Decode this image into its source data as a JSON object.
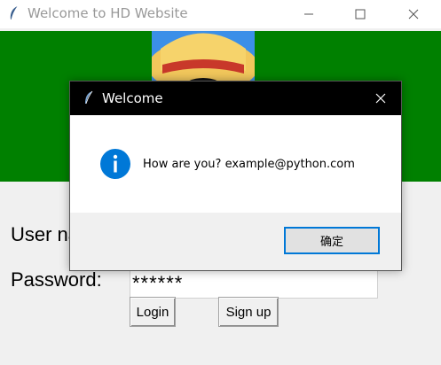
{
  "window": {
    "title": "Welcome to HD Website",
    "icon": "feather-icon"
  },
  "form": {
    "user_label": "User name:",
    "password_label": "Password:",
    "password_value": "******",
    "login_label": "Login",
    "signup_label": "Sign up"
  },
  "dialog": {
    "title": "Welcome",
    "message": "How are you? example@python.com",
    "ok_label": "确定",
    "icon": "info-icon"
  },
  "colors": {
    "banner": "#008000",
    "dialog_titlebar": "#000000",
    "accent": "#0078d7"
  }
}
